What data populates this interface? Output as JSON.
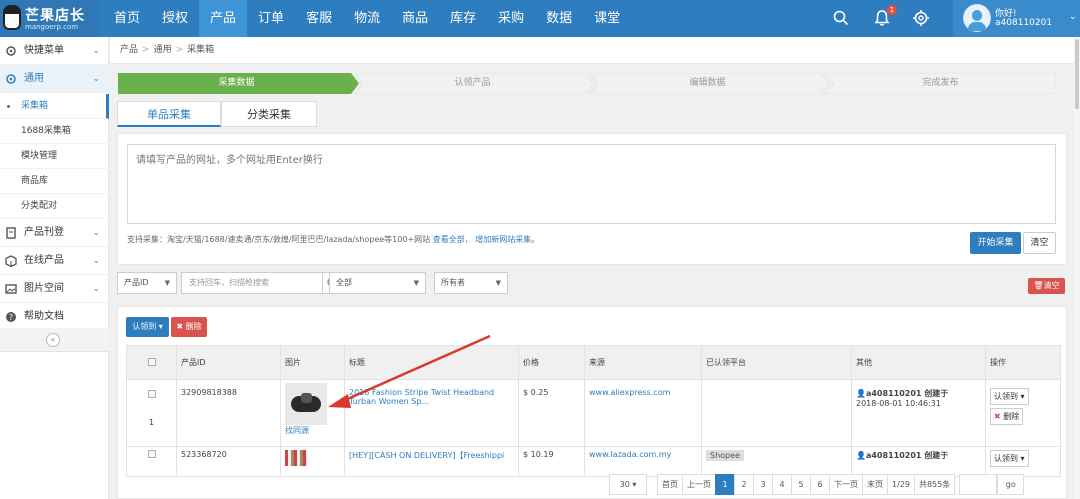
{
  "logo": {
    "title": "芒果店长",
    "subtitle": "mangoerp.com"
  },
  "nav": {
    "items": [
      "首页",
      "授权",
      "产品",
      "订单",
      "客服",
      "物流",
      "商品",
      "库存",
      "采购",
      "数据",
      "课堂"
    ],
    "active": "产品"
  },
  "notification_count": "1",
  "user": {
    "greeting": "你好!",
    "name": "a408110201"
  },
  "sidebar": {
    "groups": [
      {
        "label": "快捷菜单",
        "icon": "gear-icon"
      },
      {
        "label": "通用",
        "icon": "gear-icon"
      },
      {
        "label": "产品刊登",
        "icon": "file-icon"
      },
      {
        "label": "在线产品",
        "icon": "box-icon"
      },
      {
        "label": "图片空间",
        "icon": "image-icon"
      },
      {
        "label": "帮助文档",
        "icon": "help-icon"
      }
    ],
    "subitems": [
      "采集箱",
      "1688采集箱",
      "模块管理",
      "商品库",
      "分类配对"
    ]
  },
  "breadcrumb": [
    "产品",
    "通用",
    "采集箱"
  ],
  "steps": [
    "采集数据",
    "认领产品",
    "编辑数据",
    "完成发布"
  ],
  "tabs": [
    "单品采集",
    "分类采集"
  ],
  "collect": {
    "placeholder": "请填写产品的网址，多个网址用Enter换行",
    "support_text": "支持采集：淘宝/天猫/1688/速卖通/京东/敦煌/阿里巴巴/lazada/shopee等100+网站",
    "support_link_all": "查看全部",
    "support_link_add": "增加新网站采集",
    "start_button": "开始采集",
    "clear_button": "清空"
  },
  "filters": {
    "id_select": "产品ID",
    "search_placeholder": "支持回车，扫描枪搜索",
    "status_select": "全部",
    "owner_select": "所有者",
    "clear_button": "清空"
  },
  "actions": {
    "claim": "认领到",
    "delete": "删除"
  },
  "table": {
    "headers": [
      "",
      "产品ID",
      "图片",
      "标题",
      "价格",
      "来源",
      "已认领平台",
      "其他",
      "操作"
    ],
    "rows": [
      {
        "index": "1",
        "id": "32909818388",
        "image_link": "找同源",
        "title": "2018 Fashion Stripe Twist Headband Turban Women Sp...",
        "price": "$ 0.25",
        "source": "www.aliexpress.com",
        "platforms": "",
        "creator": "a408110201 创建于",
        "created": "2018-08-01 10:46:31",
        "op_claim": "认领到",
        "op_delete": "删除"
      },
      {
        "index": "",
        "id": "523368720",
        "image_link": "",
        "title": "[HEY][CASH ON DELIVERY]【Freeshippi",
        "price": "$ 10.19",
        "source": "www.lazada.com.my",
        "platforms": "Shopee",
        "creator": "a408110201 创建于",
        "created": "",
        "op_claim": "认领到",
        "op_delete": ""
      }
    ]
  },
  "pagination": {
    "page_size": "30",
    "first": "首页",
    "prev": "上一页",
    "pages": [
      "1",
      "2",
      "3",
      "4",
      "5",
      "6"
    ],
    "current": "1",
    "next": "下一页",
    "last": "末页",
    "page_info": "1/29",
    "total": "共855条",
    "go": "go"
  },
  "colors": {
    "primary": "#2e7ebf",
    "step_active": "#6ab04c",
    "danger": "#d9534f"
  }
}
